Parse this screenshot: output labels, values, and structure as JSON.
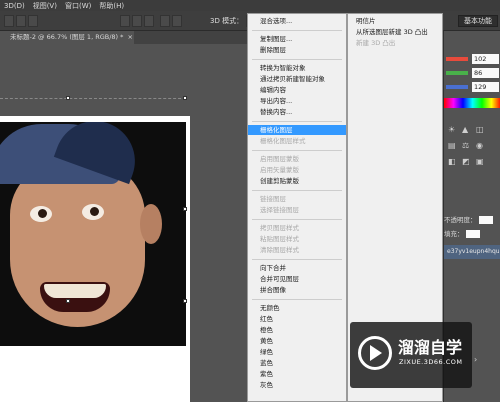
{
  "menubar": {
    "items": [
      "3D(D)",
      "视图(V)",
      "窗口(W)",
      "帮助(H)"
    ]
  },
  "optbar": {
    "mode_3d": "3D 模式：",
    "workspace": "基本功能"
  },
  "document": {
    "tab_title": "未标题-2 @ 66.7% (图层 1, RGB/8) *",
    "tab_close": "×"
  },
  "context_menu": {
    "items": [
      {
        "label": "混合选项...",
        "state": "normal"
      },
      {
        "label": "复制图层...",
        "state": "normal"
      },
      {
        "label": "删除图层",
        "state": "normal"
      },
      {
        "label": "转换为智能对象",
        "state": "normal"
      },
      {
        "label": "通过拷贝新建智能对象",
        "state": "normal"
      },
      {
        "label": "编辑内容",
        "state": "normal"
      },
      {
        "label": "导出内容...",
        "state": "normal"
      },
      {
        "label": "替换内容...",
        "state": "normal"
      },
      {
        "label": "栅格化图层",
        "state": "highlight"
      },
      {
        "label": "栅格化图层样式",
        "state": "disabled"
      },
      {
        "label": "启用图层蒙版",
        "state": "disabled"
      },
      {
        "label": "启用矢量蒙版",
        "state": "disabled"
      },
      {
        "label": "创建剪贴蒙版",
        "state": "normal"
      },
      {
        "label": "链接图层",
        "state": "disabled"
      },
      {
        "label": "选择链接图层",
        "state": "disabled"
      },
      {
        "label": "拷贝图层样式",
        "state": "disabled"
      },
      {
        "label": "粘贴图层样式",
        "state": "disabled"
      },
      {
        "label": "清除图层样式",
        "state": "disabled"
      },
      {
        "label": "向下合并",
        "state": "normal"
      },
      {
        "label": "合并可见图层",
        "state": "normal"
      },
      {
        "label": "拼合图像",
        "state": "normal"
      },
      {
        "label": "无颜色",
        "state": "normal"
      },
      {
        "label": "红色",
        "state": "normal"
      },
      {
        "label": "橙色",
        "state": "normal"
      },
      {
        "label": "黄色",
        "state": "normal"
      },
      {
        "label": "绿色",
        "state": "normal"
      },
      {
        "label": "蓝色",
        "state": "normal"
      },
      {
        "label": "紫色",
        "state": "normal"
      },
      {
        "label": "灰色",
        "state": "normal"
      }
    ]
  },
  "submenu": {
    "items": [
      {
        "label": "明信片",
        "state": "normal"
      },
      {
        "label": "从所选图层新建 3D 凸出",
        "state": "normal"
      },
      {
        "label": "新建 3D 凸出",
        "state": "disabled"
      }
    ]
  },
  "color_panel": {
    "values": [
      "102",
      "86",
      "129"
    ],
    "colors": [
      "#e84b3c",
      "#49b04a",
      "#4a6fd1"
    ]
  },
  "layers_panel": {
    "opacity_label": "不透明度：",
    "fill_label": "填充：",
    "selected_layer": "e37yv1eupn4hqu..."
  },
  "watermark": {
    "brand": "溜溜自学",
    "url": "ZIXUE.3D66.COM"
  }
}
